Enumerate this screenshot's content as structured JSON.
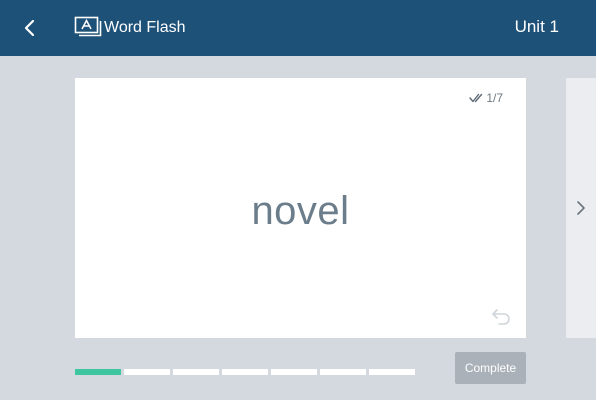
{
  "header": {
    "app_title": "Word Flash",
    "unit_label": "Unit 1",
    "background_color": "#1e5178",
    "back_icon": "chevron-left-icon",
    "app_icon": "flashcard-icon"
  },
  "card": {
    "word": "novel",
    "counter": "1/7",
    "counter_icon": "check-icon",
    "flip_icon": "flip-icon"
  },
  "next_card": {
    "icon": "chevron-right-icon"
  },
  "progress": {
    "total": 7,
    "completed": 1,
    "accent_color": "#3ec6a0"
  },
  "actions": {
    "complete_label": "Complete"
  }
}
